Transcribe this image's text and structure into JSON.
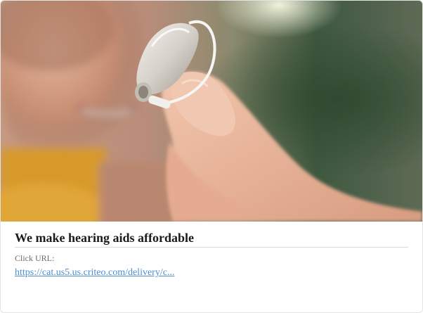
{
  "ad": {
    "image_subject": "Hand holding a hearing aid",
    "title": "We make hearing aids affordable",
    "click_url_label": "Click URL:",
    "click_url": "https://cat.us5.us.criteo.com/delivery/c..."
  }
}
